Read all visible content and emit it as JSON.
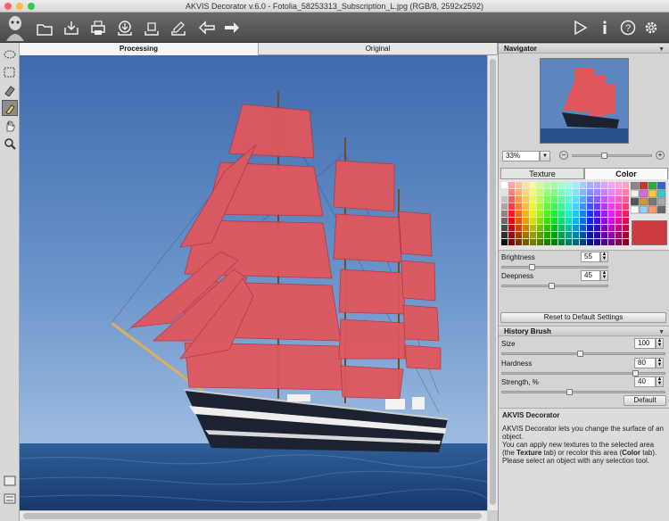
{
  "window": {
    "title": "AKVIS Decorator v.6.0 - Fotolia_58253313_Subscription_L.jpg (RGB/8, 2592x2592)"
  },
  "toolbar": {
    "left_icons": [
      "logo-icon",
      "open-icon",
      "save-icon",
      "print-icon",
      "import-icon",
      "export-icon",
      "export-settings-icon",
      "undo-icon",
      "redo-icon"
    ],
    "right_icons": [
      "run-icon",
      "info-icon",
      "help-icon",
      "settings-icon"
    ]
  },
  "tools": [
    "selection-brush-icon",
    "rectangle-select-icon",
    "eraser-icon",
    "history-brush-icon",
    "hand-icon",
    "zoom-icon"
  ],
  "view_tabs": {
    "processing": "Processing",
    "original": "Original"
  },
  "navigator": {
    "title": "Navigator",
    "zoom": "33%"
  },
  "texture_color": {
    "texture_tab": "Texture",
    "color_tab": "Color",
    "selected_color": "#cc3a3f"
  },
  "brightness": {
    "label": "Brightness",
    "value": "55"
  },
  "deepness": {
    "label": "Deepness",
    "value": "45"
  },
  "reset_label": "Reset to Default Settings",
  "history_brush": {
    "title": "History Brush",
    "size_label": "Size",
    "size_value": "100",
    "hardness_label": "Hardness",
    "hardness_value": "80",
    "strength_label": "Strength, %",
    "strength_value": "40",
    "default_label": "Default"
  },
  "info": {
    "title": "AKVIS Decorator",
    "p1": "AKVIS Decorator lets you change the surface of an object.",
    "p2a": "You can apply new textures to the selected area (the ",
    "p2b": "Texture",
    "p2c": " tab) or recolor this area (",
    "p2d": "Color",
    "p2e": " tab).",
    "p3": "Please select an object with any selection tool."
  }
}
